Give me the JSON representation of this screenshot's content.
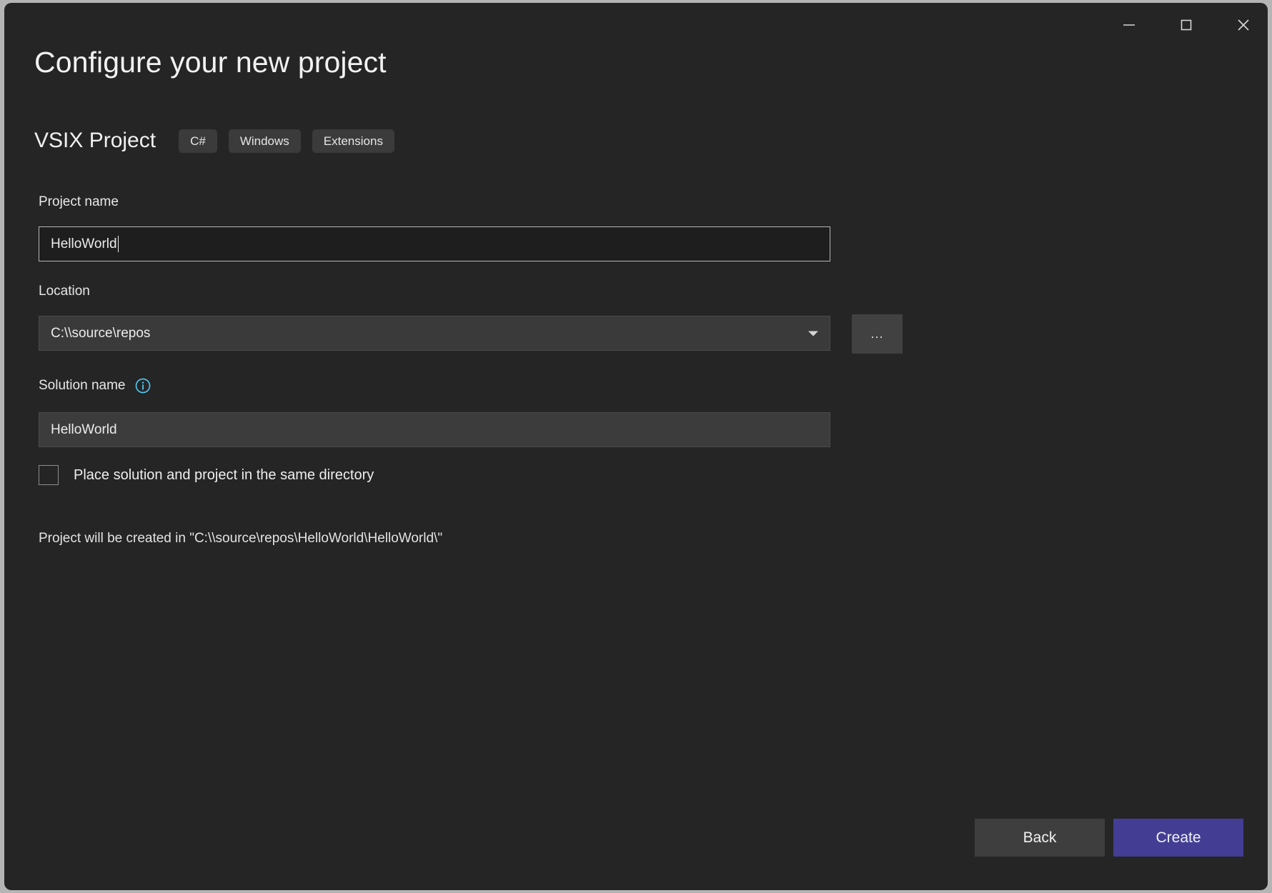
{
  "window": {
    "controls": [
      {
        "name": "minimize",
        "glyph": "minimize-icon"
      },
      {
        "name": "maximize",
        "glyph": "maximize-icon"
      },
      {
        "name": "close",
        "glyph": "close-icon"
      }
    ],
    "background": "#252526",
    "outer_background": "#b5b5b5"
  },
  "header": {
    "title": "Configure your new project",
    "template_name": "VSIX Project",
    "tags": [
      "C#",
      "Windows",
      "Extensions"
    ]
  },
  "fields": {
    "project_name": {
      "label": "Project name",
      "value": "HelloWorld",
      "focused": true
    },
    "location": {
      "label": "Location",
      "value": "C:\\\\source\\repos",
      "dropdown_icon": "chevron-down-icon",
      "browse_label": "..."
    },
    "solution_name": {
      "label": "Solution name",
      "info_icon": "info-icon",
      "value": "HelloWorld"
    },
    "same_directory": {
      "label": "Place solution and project in the same directory",
      "checked": false
    }
  },
  "status": {
    "created_in": "Project will be created in \"C:\\\\source\\repos\\HelloWorld\\HelloWorld\\\""
  },
  "footer": {
    "back_label": "Back",
    "create_label": "Create",
    "create_color": "#433e94",
    "back_color": "#3e3e3f"
  },
  "colors": {
    "accent": "#433e94",
    "info_icon": "#4fc3e8",
    "focus_border": "#b6b6b6"
  }
}
